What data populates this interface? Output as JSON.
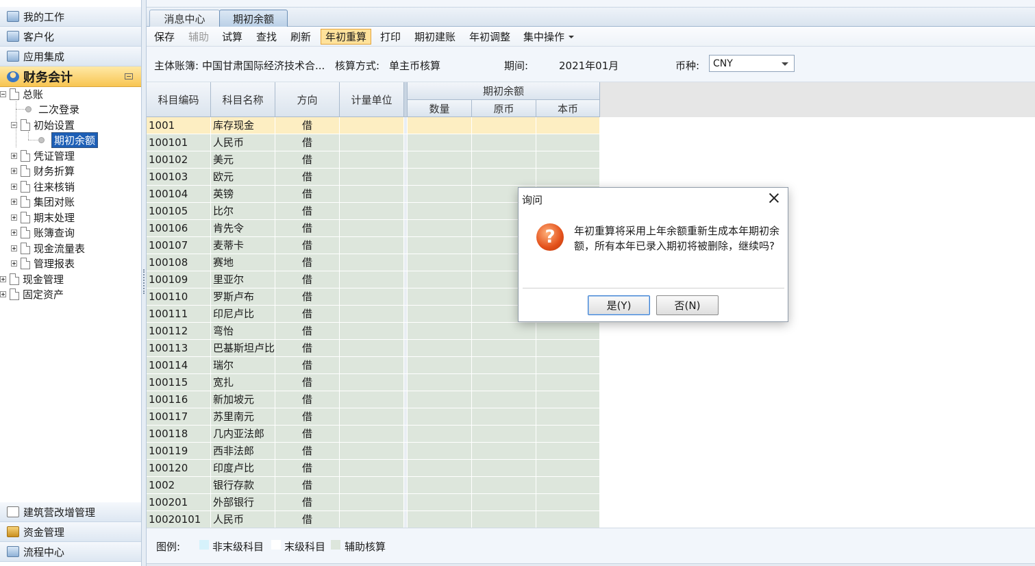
{
  "nav": {
    "top_items": [
      {
        "label": "我的工作",
        "icon": "my-work-icon"
      },
      {
        "label": "客户化",
        "icon": "customize-icon"
      },
      {
        "label": "应用集成",
        "icon": "app-integration-icon"
      }
    ],
    "active_module": "财务会计",
    "tree": {
      "general_ledger": "总账",
      "secondary_login": "二次登录",
      "initial_settings": "初始设置",
      "opening_balance": "期初余额",
      "voucher_mgmt": "凭证管理",
      "finance_convert": "财务折算",
      "ar_ap_verify": "往来核销",
      "group_reconcile": "集团对账",
      "period_end": "期末处理",
      "ledger_query": "账簿查询",
      "cashflow": "现金流量表",
      "mgmt_reports": "管理报表",
      "cash_mgmt": "现金管理",
      "fixed_assets": "固定资产"
    },
    "bottom_items": [
      {
        "label": "建筑营改增管理",
        "icon": "document-icon"
      },
      {
        "label": "资金管理",
        "icon": "funds-icon"
      },
      {
        "label": "流程中心",
        "icon": "workflow-icon"
      }
    ]
  },
  "tabs": [
    {
      "label": "消息中心",
      "active": false
    },
    {
      "label": "期初余额",
      "active": true
    }
  ],
  "toolbar": {
    "save": "保存",
    "assist": "辅助",
    "trial": "试算",
    "find": "查找",
    "refresh": "刷新",
    "year_recalc": "年初重算",
    "print": "打印",
    "opening_setup": "期初建账",
    "year_adjust": "年初调整",
    "batch_ops": "集中操作"
  },
  "info": {
    "ledger_label": "主体账簿:",
    "ledger_value": "中国甘肃国际经济技术合...",
    "method_label": "核算方式:",
    "method_value": "单主币核算",
    "period_label": "期间:",
    "period_value": "2021年01月",
    "currency_label": "币种:",
    "currency_value": "CNY"
  },
  "grid": {
    "headers": {
      "code": "科目编码",
      "name": "科目名称",
      "direction": "方向",
      "unit": "计量单位",
      "opening_group": "期初余额",
      "qty": "数量",
      "orig": "原币",
      "local": "本币"
    },
    "rows": [
      {
        "code": "1001",
        "name": "库存现金",
        "dir": "借"
      },
      {
        "code": "100101",
        "name": "人民币",
        "dir": "借"
      },
      {
        "code": "100102",
        "name": "美元",
        "dir": "借"
      },
      {
        "code": "100103",
        "name": "欧元",
        "dir": "借"
      },
      {
        "code": "100104",
        "name": "英镑",
        "dir": "借"
      },
      {
        "code": "100105",
        "name": "比尔",
        "dir": "借"
      },
      {
        "code": "100106",
        "name": "肯先令",
        "dir": "借"
      },
      {
        "code": "100107",
        "name": "麦蒂卡",
        "dir": "借"
      },
      {
        "code": "100108",
        "name": "赛地",
        "dir": "借"
      },
      {
        "code": "100109",
        "name": "里亚尔",
        "dir": "借"
      },
      {
        "code": "100110",
        "name": "罗斯卢布",
        "dir": "借"
      },
      {
        "code": "100111",
        "name": "印尼卢比",
        "dir": "借"
      },
      {
        "code": "100112",
        "name": "弯怡",
        "dir": "借"
      },
      {
        "code": "100113",
        "name": "巴基斯坦卢比",
        "dir": "借"
      },
      {
        "code": "100114",
        "name": "瑞尔",
        "dir": "借"
      },
      {
        "code": "100115",
        "name": "宽扎",
        "dir": "借"
      },
      {
        "code": "100116",
        "name": "新加坡元",
        "dir": "借"
      },
      {
        "code": "100117",
        "name": "苏里南元",
        "dir": "借"
      },
      {
        "code": "100118",
        "name": "几内亚法郎",
        "dir": "借"
      },
      {
        "code": "100119",
        "name": "西非法郎",
        "dir": "借"
      },
      {
        "code": "100120",
        "name": "印度卢比",
        "dir": "借"
      },
      {
        "code": "1002",
        "name": "银行存款",
        "dir": "借"
      },
      {
        "code": "100201",
        "name": "外部银行",
        "dir": "借"
      },
      {
        "code": "10020101",
        "name": "人民币",
        "dir": "借"
      }
    ]
  },
  "legend": {
    "label": "图例:",
    "non_leaf": "非末级科目",
    "leaf": "末级科目",
    "aux": "辅助核算",
    "colors": {
      "non_leaf": "#d6f2fb",
      "leaf": "#ffffff",
      "aux": "#dde6dc"
    }
  },
  "dialog": {
    "title": "询问",
    "message": "年初重算将采用上年余额重新生成本年期初余额，所有本年已录入期初将被删除，继续吗?",
    "yes": "是(Y)",
    "no": "否(N)",
    "icon": "question-icon"
  }
}
